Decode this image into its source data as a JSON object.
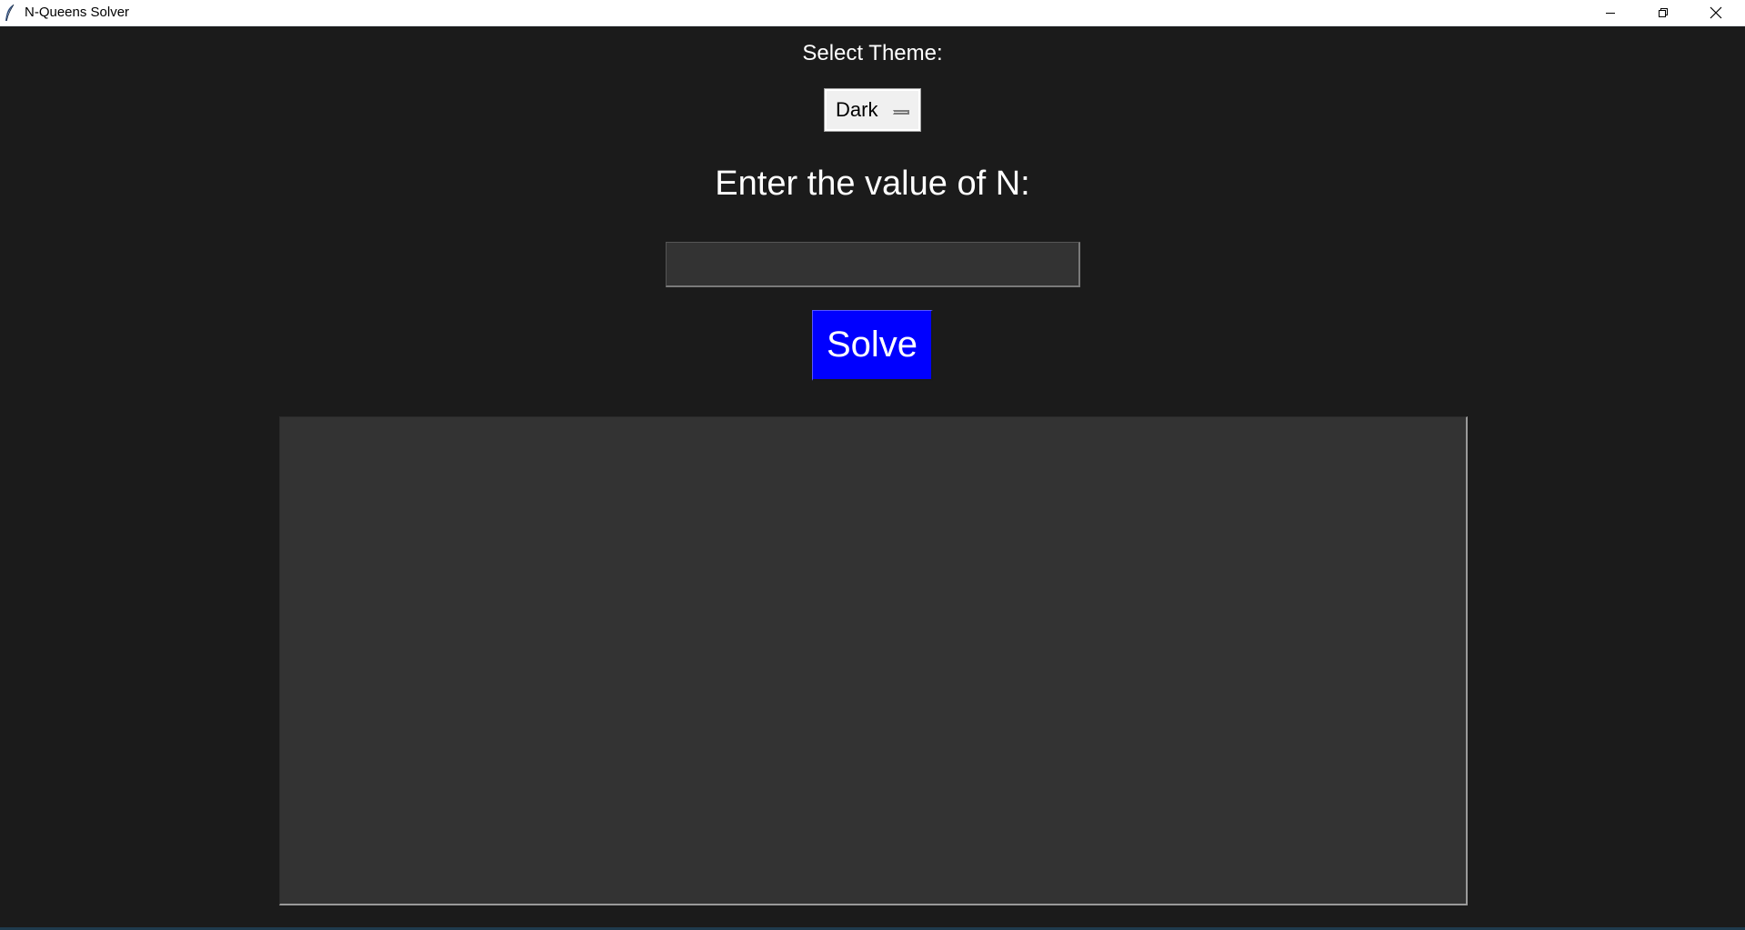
{
  "window": {
    "title": "N-Queens Solver",
    "icon": "feather-icon",
    "controls": {
      "minimize_icon": "minimize-icon",
      "maximize_icon": "restore-icon",
      "close_icon": "close-icon"
    }
  },
  "theme": {
    "label": "Select Theme:",
    "selected": "Dark"
  },
  "n_input": {
    "label": "Enter the value of N:",
    "value": ""
  },
  "solve": {
    "label": "Solve"
  },
  "colors": {
    "background": "#1b1b1b",
    "panel": "#333333",
    "solve_button": "#0000ff",
    "text": "#ffffff"
  }
}
